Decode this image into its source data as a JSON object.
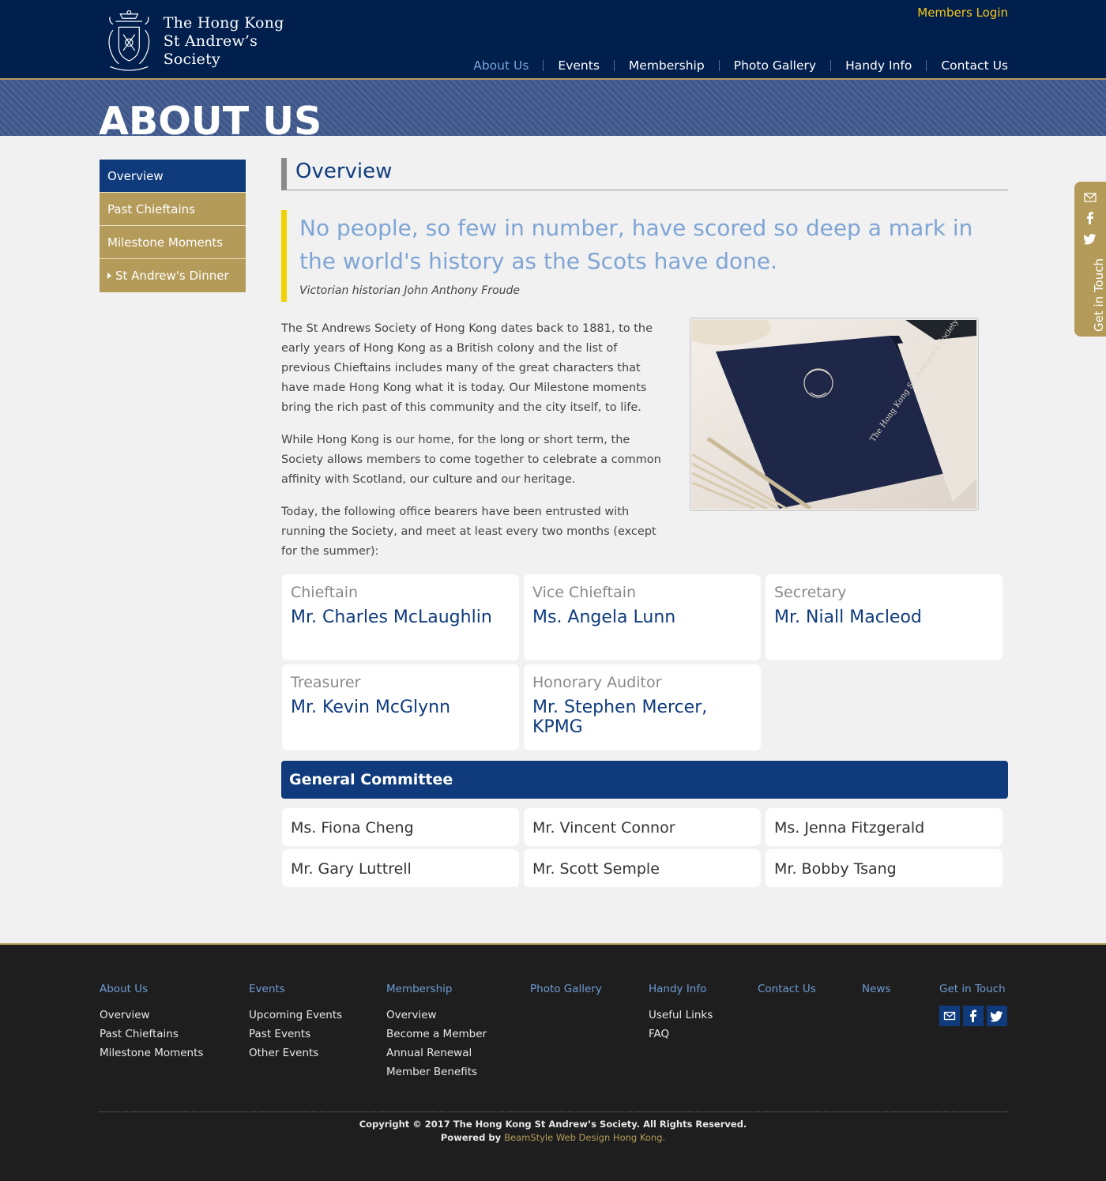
{
  "header": {
    "logo_line1": "The Hong Kong",
    "logo_line2": "St Andrew’s Society",
    "members_login": "Members Login",
    "nav": {
      "home_icon": "home-icon",
      "about": "About Us",
      "events": "Events",
      "membership": "Membership",
      "gallery": "Photo Gallery",
      "handy": "Handy Info",
      "contact": "Contact Us"
    }
  },
  "banner": {
    "title": "ABOUT US"
  },
  "sidebar": {
    "items": [
      "Overview",
      "Past Chieftains",
      "Milestone Moments",
      "St Andrew's Dinner"
    ]
  },
  "main": {
    "title": "Overview",
    "quote": "No people, so few in number, have scored so deep a mark in the world's history as the Scots have done.",
    "quote_cite": "Victorian historian John Anthony Froude",
    "paragraphs": [
      "The St Andrews Society of Hong Kong dates back to 1881, to the early years of Hong Kong as a British colony and the list of previous Chieftains includes many of the great characters that have made Hong Kong what it is today. Our Milestone moments bring the rich past of this community and the city itself, to life.",
      "While Hong Kong is our home, for the long or short term, the Society allows members to come together to celebrate a common affinity with Scotland, our culture and our heritage.",
      "Today, the following office bearers have been entrusted with running the Society, and meet at least every two months (except for the summer):"
    ],
    "photo_text": "The Hong Kong St. Andrew's Society",
    "officers": [
      {
        "role": "Chieftain",
        "name": "Mr.  Charles McLaughlin"
      },
      {
        "role": "Vice Chieftain",
        "name": "Ms. Angela Lunn"
      },
      {
        "role": "Secretary",
        "name": "Mr.  Niall Macleod"
      },
      {
        "role": "Treasurer",
        "name": "Mr. Kevin McGlynn"
      },
      {
        "role": "Honorary Auditor",
        "name": "Mr. Stephen Mercer, KPMG"
      }
    ],
    "committee_title": "General Committee",
    "committee": [
      "Ms. Fiona Cheng",
      "Mr. Vincent Connor",
      "Ms. Jenna Fitzgerald",
      "Mr. Gary Luttrell",
      "Mr. Scott Semple",
      "Mr. Bobby Tsang"
    ]
  },
  "side_tab": {
    "label": "Get in Touch"
  },
  "footer": {
    "about": {
      "head": "About Us",
      "links": [
        "Overview",
        "Past Chieftains",
        "Milestone Moments"
      ]
    },
    "events": {
      "head": "Events",
      "links": [
        "Upcoming Events",
        "Past Events",
        "Other Events"
      ]
    },
    "membership": {
      "head": "Membership",
      "links": [
        "Overview",
        "Become a Member",
        "Annual Renewal",
        "Member Benefits"
      ]
    },
    "gallery": {
      "head": "Photo Gallery"
    },
    "handy": {
      "head": "Handy Info",
      "links": [
        "Useful Links",
        "FAQ"
      ]
    },
    "contact": {
      "head": "Contact Us"
    },
    "news": {
      "head": "News"
    },
    "touch": {
      "head": "Get in Touch"
    },
    "copyright": "Copyright © 2017 The Hong Kong St Andrew’s Society. All Rights Reserved.",
    "powered_prefix": "Powered by",
    "powered_brand": "BeamStyle Web Design Hong Kong."
  },
  "colors": {
    "navy": "#001f4d",
    "blue": "#0f3b7d",
    "gold": "#b59b5a",
    "quote_bar": "#f2d100",
    "quote_text": "#7fa5d6",
    "login": "#f5c518"
  }
}
